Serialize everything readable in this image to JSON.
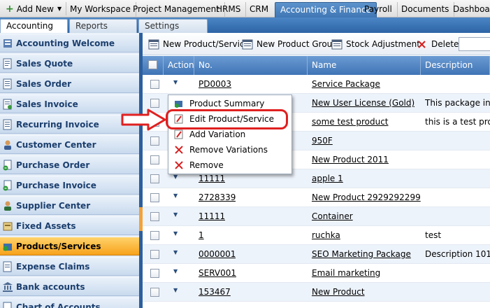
{
  "topnav": {
    "add_new": "Add New",
    "tabs": [
      "My Workspace",
      "Project Management",
      "HRMS",
      "CRM",
      "Accounting & Finance",
      "Payroll",
      "Documents",
      "Dashboard"
    ],
    "active_tab": "Accounting & Finance"
  },
  "subtabs": [
    "Accounting",
    "Reports",
    "Settings"
  ],
  "sidebar": {
    "items": [
      {
        "label": "Accounting Welcome",
        "icon": "book-icon"
      },
      {
        "label": "Sales Quote",
        "icon": "quote-icon"
      },
      {
        "label": "Sales Order",
        "icon": "order-icon"
      },
      {
        "label": "Sales Invoice",
        "icon": "invoice-icon"
      },
      {
        "label": "Recurring Invoice",
        "icon": "recurring-invoice-icon"
      },
      {
        "label": "Customer Center",
        "icon": "customer-icon"
      },
      {
        "label": "Purchase Order",
        "icon": "purchase-order-icon"
      },
      {
        "label": "Purchase Invoice",
        "icon": "purchase-invoice-icon"
      },
      {
        "label": "Supplier Center",
        "icon": "supplier-icon"
      },
      {
        "label": "Fixed Assets",
        "icon": "assets-icon"
      },
      {
        "label": "Products/Services",
        "icon": "products-icon"
      },
      {
        "label": "Expense Claims",
        "icon": "expense-icon"
      },
      {
        "label": "Bank accounts",
        "icon": "bank-icon"
      },
      {
        "label": "Chart of Accounts",
        "icon": "chart-of-accounts-icon"
      }
    ],
    "active": "Products/Services"
  },
  "toolbar": {
    "new_product": "New Product/Service",
    "new_group": "New Product Group",
    "stock_adjustment": "Stock Adjustment",
    "delete": "Delete"
  },
  "grid": {
    "headers": [
      "Action",
      "No.",
      "Name",
      "Description"
    ],
    "rows": [
      {
        "no": "PD0003",
        "name": "Service Package",
        "desc": ""
      },
      {
        "no": "",
        "name": "New User License (Gold)",
        "desc": "This package includ"
      },
      {
        "no": "",
        "name": "some test product",
        "desc": "this is a test produc"
      },
      {
        "no": "",
        "name": "950F",
        "desc": ""
      },
      {
        "no": "",
        "name": "New Product 2011",
        "desc": ""
      },
      {
        "no": "11111",
        "name": "apple 1",
        "desc": ""
      },
      {
        "no": "2728339",
        "name": "New Product 2929292299",
        "desc": ""
      },
      {
        "no": "11111",
        "name": "Container",
        "desc": ""
      },
      {
        "no": "1",
        "name": "ruchka",
        "desc": "test"
      },
      {
        "no": "0000001",
        "name": "SEO Marketing Package",
        "desc": "Description 101"
      },
      {
        "no": "SERV001",
        "name": "Email marketing",
        "desc": ""
      },
      {
        "no": "153467",
        "name": "New Product",
        "desc": ""
      }
    ]
  },
  "context_menu": {
    "items": [
      {
        "label": "Product Summary",
        "icon": "summary-icon"
      },
      {
        "label": "Edit Product/Service",
        "icon": "edit-icon"
      },
      {
        "label": "Add Variation",
        "icon": "add-variation-icon"
      },
      {
        "label": "Remove Variations",
        "icon": "remove-variations-icon"
      },
      {
        "label": "Remove",
        "icon": "remove-icon"
      }
    ]
  },
  "colors": {
    "nav_active": "#3f76b4",
    "sidebar_active": "#f7a21b",
    "highlight": "#e02020"
  }
}
